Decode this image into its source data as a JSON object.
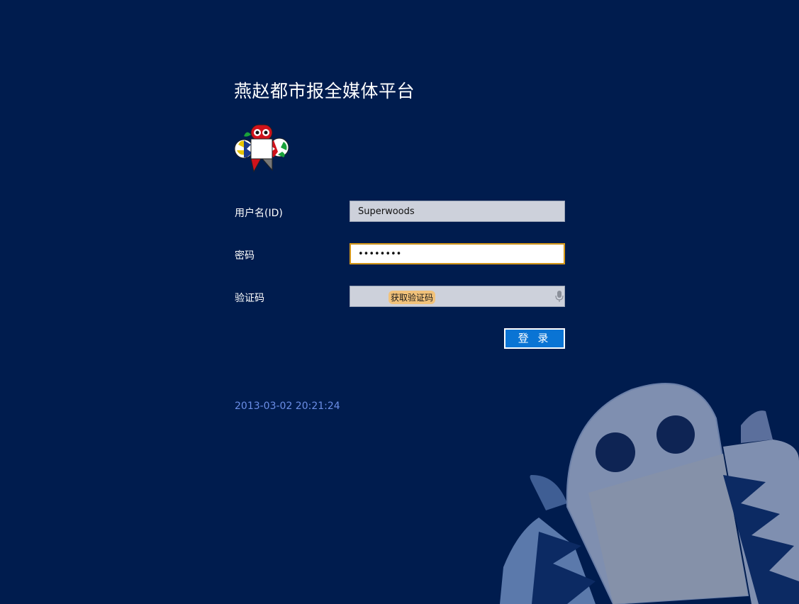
{
  "header": {
    "title": "燕赵都市报全媒体平台"
  },
  "form": {
    "username": {
      "label": "用户名(ID)",
      "value": "Superwoods"
    },
    "password": {
      "label": "密码",
      "value": "••••••••"
    },
    "captcha": {
      "label": "验证码",
      "link_text": "获取验证码",
      "value": ""
    },
    "login_button": "登 录"
  },
  "footer": {
    "timestamp": "2013-03-02 20:21:24"
  },
  "icons": {
    "logo": "owl-logo-icon",
    "mic": "microphone-icon",
    "background": "owl-mascot-icon"
  },
  "colors": {
    "background": "#001c4e",
    "button": "#0a74d4",
    "timestamp": "#6b8ee6",
    "input": "#cdd1db"
  }
}
